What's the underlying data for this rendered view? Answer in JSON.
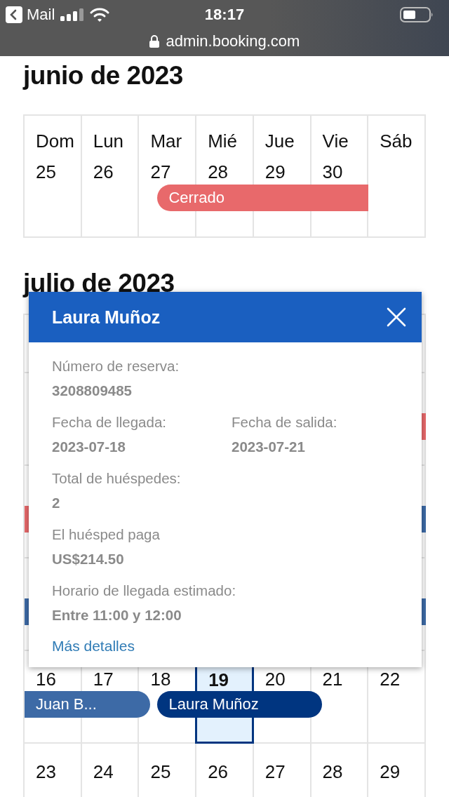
{
  "status_bar": {
    "back_label": "Mail",
    "time": "18:17",
    "url": "admin.booking.com"
  },
  "months": [
    {
      "title": "junio de 2023",
      "weeks": [
        {
          "kind": "week",
          "days": [
            {
              "weekday": "Dom",
              "number": "25",
              "selected": false
            },
            {
              "weekday": "Lun",
              "number": "26",
              "selected": false
            },
            {
              "weekday": "Mar",
              "number": "27",
              "selected": false
            },
            {
              "weekday": "Mié",
              "number": "28",
              "selected": false
            },
            {
              "weekday": "Jue",
              "number": "29",
              "selected": false
            },
            {
              "weekday": "Vie",
              "number": "30",
              "selected": false
            },
            {
              "weekday": "Sáb"
            }
          ],
          "bars": [
            {
              "kind": "closed",
              "label": "Cerrado",
              "open_left": false,
              "open_right": true
            }
          ]
        }
      ]
    },
    {
      "title": "julio de 2023",
      "weeks": [
        {
          "kind": "header"
        },
        {
          "kind": "week",
          "bars": [
            {
              "kind": "closed",
              "open_left": false,
              "open_right": true
            }
          ]
        },
        {
          "kind": "week",
          "bars": [
            {
              "kind": "closed",
              "open_left": true,
              "open_right": false
            },
            {
              "kind": "booking",
              "selected": false,
              "open_left": false,
              "open_right": true
            }
          ]
        },
        {
          "kind": "week",
          "bars": [
            {
              "kind": "booking",
              "selected": false,
              "open_left": true,
              "open_right": false
            },
            {
              "kind": "booking",
              "selected": false,
              "open_left": false,
              "open_right": true
            }
          ]
        },
        {
          "kind": "week",
          "days": [
            {
              "number": "16",
              "selected": false
            },
            {
              "number": "17",
              "selected": false
            },
            {
              "number": "18",
              "selected": false
            },
            {
              "number": "19",
              "selected": true
            },
            {
              "number": "20",
              "selected": false
            },
            {
              "number": "21",
              "selected": false
            },
            {
              "number": "22",
              "selected": false
            }
          ],
          "bars": [
            {
              "kind": "booking",
              "label": "Juan B...",
              "selected": false,
              "open_left": true,
              "open_right": false
            },
            {
              "kind": "booking",
              "label": "Laura Muñoz",
              "selected": true,
              "open_left": false,
              "open_right": false
            }
          ]
        },
        {
          "kind": "week",
          "days": [
            {
              "number": "23",
              "selected": false
            },
            {
              "number": "24",
              "selected": false
            },
            {
              "number": "25",
              "selected": false
            },
            {
              "number": "26",
              "selected": false
            },
            {
              "number": "27",
              "selected": false
            },
            {
              "number": "28",
              "selected": false
            },
            {
              "number": "29",
              "selected": false
            }
          ]
        }
      ]
    }
  ],
  "popup": {
    "title": "Laura Muñoz",
    "rows": [
      [
        {
          "label": "Número de reserva:",
          "value": "3208809485"
        }
      ],
      [
        {
          "label": "Fecha de llegada:",
          "value": "2023-07-18"
        },
        {
          "label": "Fecha de salida:",
          "value": "2023-07-21"
        }
      ],
      [
        {
          "label": "Total de huéspedes:",
          "value": "2"
        }
      ],
      [
        {
          "label": "El huésped paga",
          "value": "US$214.50"
        }
      ],
      [
        {
          "label": "Horario de llegada estimado:",
          "value": "Entre 11:00 y 12:00"
        }
      ]
    ],
    "link": "Más detalles"
  }
}
